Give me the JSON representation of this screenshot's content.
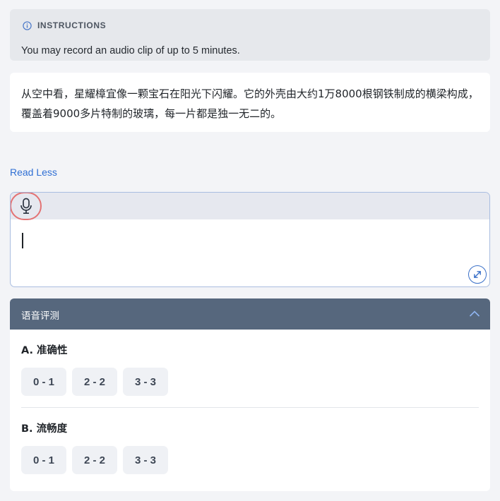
{
  "instructions": {
    "icon": "info-icon",
    "title": "INSTRUCTIONS",
    "text": "You may record an audio clip of up to 5 minutes."
  },
  "passage": {
    "text": "从空中看，星耀樟宜像一颗宝石在阳光下闪耀。它的外壳由大约1万8000根钢铁制成的横梁构成，覆盖着9000多片特制的玻璃，每一片都是独一无二的。"
  },
  "read_less": "Read Less",
  "recorder": {
    "mic_icon": "microphone-icon",
    "expand_icon": "expand-icon",
    "accent_color": "#e37273"
  },
  "evaluation": {
    "title": "语音评测",
    "collapse_icon": "chevron-up-icon",
    "sections": [
      {
        "label": "A. 准确性",
        "options": [
          "0 - 1",
          "2 - 2",
          "3 - 3"
        ]
      },
      {
        "label": "B. 流畅度",
        "options": [
          "0 - 1",
          "2 - 2",
          "3 - 3"
        ]
      }
    ]
  }
}
